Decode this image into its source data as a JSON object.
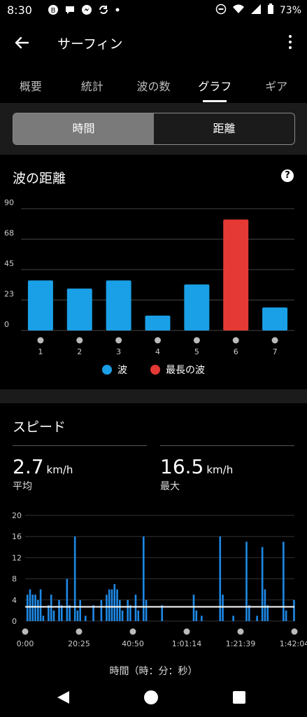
{
  "status": {
    "time": "8:30",
    "battery": "73%"
  },
  "header": {
    "title": "サーフィン"
  },
  "tabs": [
    {
      "label": "概要",
      "active": false
    },
    {
      "label": "統計",
      "active": false
    },
    {
      "label": "波の数",
      "active": false
    },
    {
      "label": "グラフ",
      "active": true
    },
    {
      "label": "ギア",
      "active": false
    }
  ],
  "toggle": {
    "time": "時間",
    "distance": "距離"
  },
  "wave_card": {
    "title": "波の距離",
    "legend_wave": "波",
    "legend_longest": "最長の波"
  },
  "speed_card": {
    "title": "スピード",
    "avg_value": "2.7",
    "avg_unit": "km/h",
    "avg_label": "平均",
    "max_value": "16.5",
    "max_unit": "km/h",
    "max_label": "最大",
    "xlabel": "時間（時：分：秒）"
  },
  "colors": {
    "bar": "#1aa0e6",
    "longest": "#e53935",
    "speed": "#1e88e5"
  },
  "chart_data": [
    {
      "type": "bar",
      "title": "波の距離",
      "categories": [
        "1",
        "2",
        "3",
        "4",
        "5",
        "6",
        "7"
      ],
      "series": [
        {
          "name": "波",
          "values": [
            37,
            31,
            37,
            11,
            34,
            82,
            17
          ]
        }
      ],
      "highlight_index": 5,
      "highlight_name": "最長の波",
      "yticks": [
        "0",
        "23",
        "45",
        "68",
        "90"
      ],
      "ylim": [
        0,
        90
      ],
      "grid": true,
      "legend": "bottom"
    },
    {
      "type": "area",
      "title": "スピード",
      "xlabel": "時間（時：分：秒）",
      "xticks": [
        "0:00",
        "20:25",
        "40:50",
        "1:01:14",
        "1:21:39",
        "1:42:04"
      ],
      "yticks": [
        "0",
        "4",
        "8",
        "12",
        "16",
        "20"
      ],
      "ylim": [
        0,
        20
      ],
      "average": 2.7,
      "x_minutes": [
        0,
        1,
        2,
        3,
        4,
        5,
        6,
        7,
        8,
        9,
        10,
        11,
        12,
        13,
        14,
        15,
        16,
        17,
        18,
        19,
        20,
        21,
        22,
        23,
        24,
        25,
        26,
        27,
        28,
        29,
        30,
        31,
        32,
        33,
        34,
        35,
        36,
        37,
        38,
        39,
        40,
        41,
        42,
        43,
        44,
        45,
        46,
        47,
        48,
        49,
        50,
        51,
        52,
        53,
        54,
        55,
        56,
        57,
        58,
        59,
        60,
        61,
        62,
        63,
        64,
        65,
        66,
        67,
        68,
        69,
        70,
        71,
        72,
        73,
        74,
        75,
        76,
        77,
        78,
        79,
        80,
        81,
        82,
        83,
        84,
        85,
        86,
        87,
        88,
        89,
        90,
        91,
        92,
        93,
        94,
        95,
        96,
        97,
        98,
        99,
        100,
        101,
        102
      ],
      "values": [
        0,
        5,
        6,
        5,
        5,
        4,
        6,
        1,
        0,
        3,
        5,
        2,
        0,
        4,
        3,
        0,
        8,
        3,
        0,
        16,
        2,
        4,
        0,
        1,
        0,
        0,
        3,
        0,
        0,
        4,
        0,
        5,
        6,
        6,
        7,
        6,
        4,
        2,
        0,
        4,
        3,
        0,
        5,
        2,
        0,
        16,
        4,
        0,
        0,
        0,
        0,
        0,
        3,
        0,
        0,
        0,
        0,
        0,
        0,
        0,
        0,
        0,
        0,
        0,
        5,
        2,
        0,
        1,
        0,
        0,
        0,
        0,
        0,
        0,
        16,
        5,
        0,
        0,
        0,
        1,
        0,
        0,
        0,
        0,
        15,
        3,
        0,
        0,
        1,
        0,
        14,
        6,
        3,
        0,
        0,
        0,
        0,
        0,
        15,
        2,
        0,
        0,
        4
      ]
    }
  ]
}
